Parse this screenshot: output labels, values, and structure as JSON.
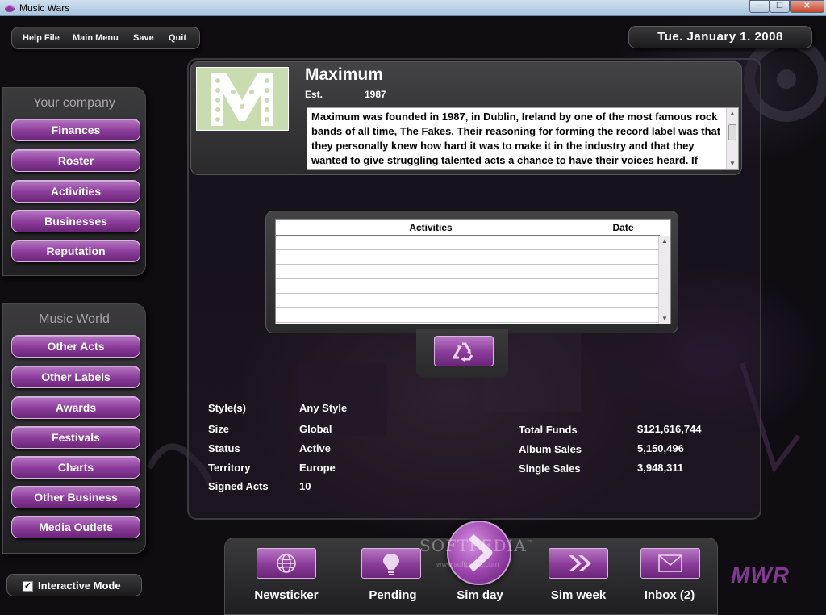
{
  "window": {
    "title": "Music Wars",
    "min_glyph": "—",
    "max_glyph": "☐",
    "close_glyph": "✕"
  },
  "menu": {
    "help": "Help File",
    "main": "Main Menu",
    "save": "Save",
    "quit": "Quit"
  },
  "date": "Tue. January 1. 2008",
  "company_panel": {
    "heading": "Your company",
    "items": [
      "Finances",
      "Roster",
      "Activities",
      "Businesses",
      "Reputation"
    ]
  },
  "world_panel": {
    "heading": "Music World",
    "items": [
      "Other Acts",
      "Other Labels",
      "Awards",
      "Festivals",
      "Charts",
      "Other Business",
      "Media Outlets"
    ]
  },
  "interactive_mode": {
    "label": "Interactive Mode",
    "checked": true,
    "check_glyph": "✓"
  },
  "company": {
    "name": "Maximum",
    "est_label": "Est.",
    "est_year": "1987",
    "description": "Maximum was founded in 1987, in Dublin, Ireland by one of the most famous rock bands of all time, The Fakes. Their reasoning for forming the record label was that they personally knew how hard it was to make it in the industry and that they wanted to give struggling talented acts a chance to have their voices heard. If other major labels are the gods on high that dangle the carrot..."
  },
  "activities_table": {
    "headers": [
      "Activities",
      "Date"
    ],
    "rows": [
      [
        "",
        ""
      ],
      [
        "",
        ""
      ],
      [
        "",
        ""
      ],
      [
        "",
        ""
      ],
      [
        "",
        ""
      ],
      [
        "",
        ""
      ]
    ]
  },
  "stats_left": [
    {
      "label": "Style(s)",
      "value": "Any Style"
    },
    {
      "label": "Size",
      "value": "Global"
    },
    {
      "label": "Status",
      "value": "Active"
    },
    {
      "label": "Territory",
      "value": "Europe"
    },
    {
      "label": "Signed Acts",
      "value": "10"
    }
  ],
  "stats_right": [
    {
      "label": "Total Funds",
      "value": "$121,616,744"
    },
    {
      "label": "Album Sales",
      "value": "5,150,496"
    },
    {
      "label": "Single Sales",
      "value": "3,948,311"
    }
  ],
  "dock": {
    "newsticker": "Newsticker",
    "pending": "Pending",
    "simday": "Sim day",
    "simweek": "Sim week",
    "inbox": "Inbox (2)"
  },
  "watermark": {
    "main": "SOFTPEDIA",
    "sub": "www.softpedia.com",
    "tm": "™"
  },
  "brand_logo": "MWR",
  "colors": {
    "button_purple": "#8a3b98",
    "panel_dark": "#2a292c",
    "accent_border": "#d7b5dd"
  },
  "icons": {
    "newsticker": "globe-icon",
    "pending": "lightbulb-icon",
    "simday": "chevron-right-icon",
    "simweek": "double-chevron-icon",
    "inbox": "envelope-icon",
    "recycle": "recycle-icon"
  }
}
